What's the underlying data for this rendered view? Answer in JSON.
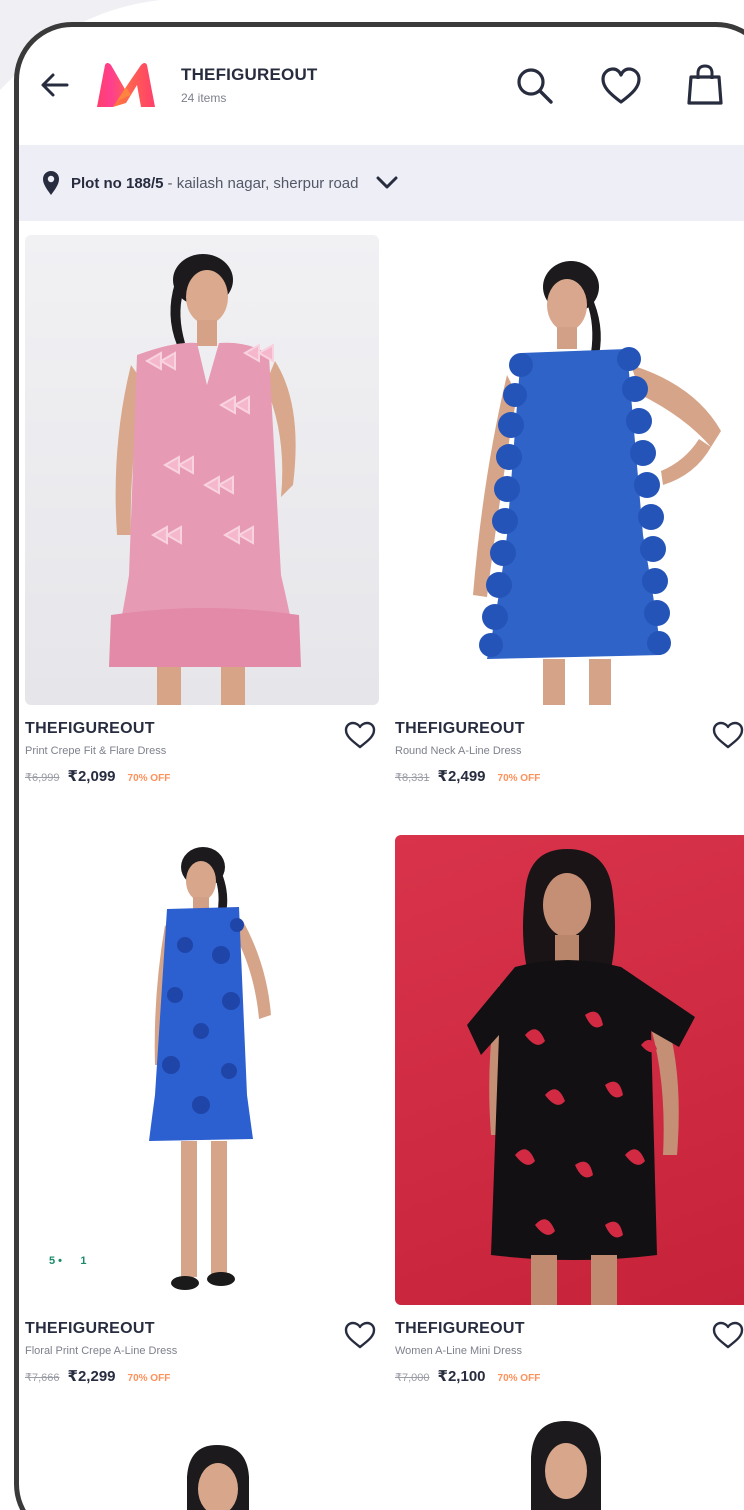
{
  "header": {
    "brand_title": "THEFIGUREOUT",
    "item_count": "24 items"
  },
  "address": {
    "bold": "Plot no 188/5",
    "rest": "- kailash nagar, sherpur road"
  },
  "products": [
    {
      "brand": "THEFIGUREOUT",
      "desc": "Print Crepe Fit & Flare Dress",
      "mrp": "₹6,999",
      "price": "₹2,099",
      "off": "70% OFF"
    },
    {
      "brand": "THEFIGUREOUT",
      "desc": "Round Neck A-Line Dress",
      "mrp": "₹8,331",
      "price": "₹2,499",
      "off": "70% OFF"
    },
    {
      "brand": "THEFIGUREOUT",
      "desc": "Floral Print Crepe A-Line Dress",
      "mrp": "₹7,666",
      "price": "₹2,299",
      "off": "70% OFF"
    },
    {
      "brand": "THEFIGUREOUT",
      "desc": "Women A-Line Mini Dress",
      "mrp": "₹7,000",
      "price": "₹2,100",
      "off": "70% OFF"
    }
  ],
  "colors": {
    "brand_pink": "#ff3f6c",
    "brand_orange": "#ff905a",
    "address_bg": "#eeeff6",
    "text_dark": "#282c3f"
  },
  "icons": [
    "back-arrow-icon",
    "myntra-logo",
    "search-icon",
    "heart-icon",
    "bag-icon",
    "location-pin-icon",
    "chevron-down-icon"
  ]
}
